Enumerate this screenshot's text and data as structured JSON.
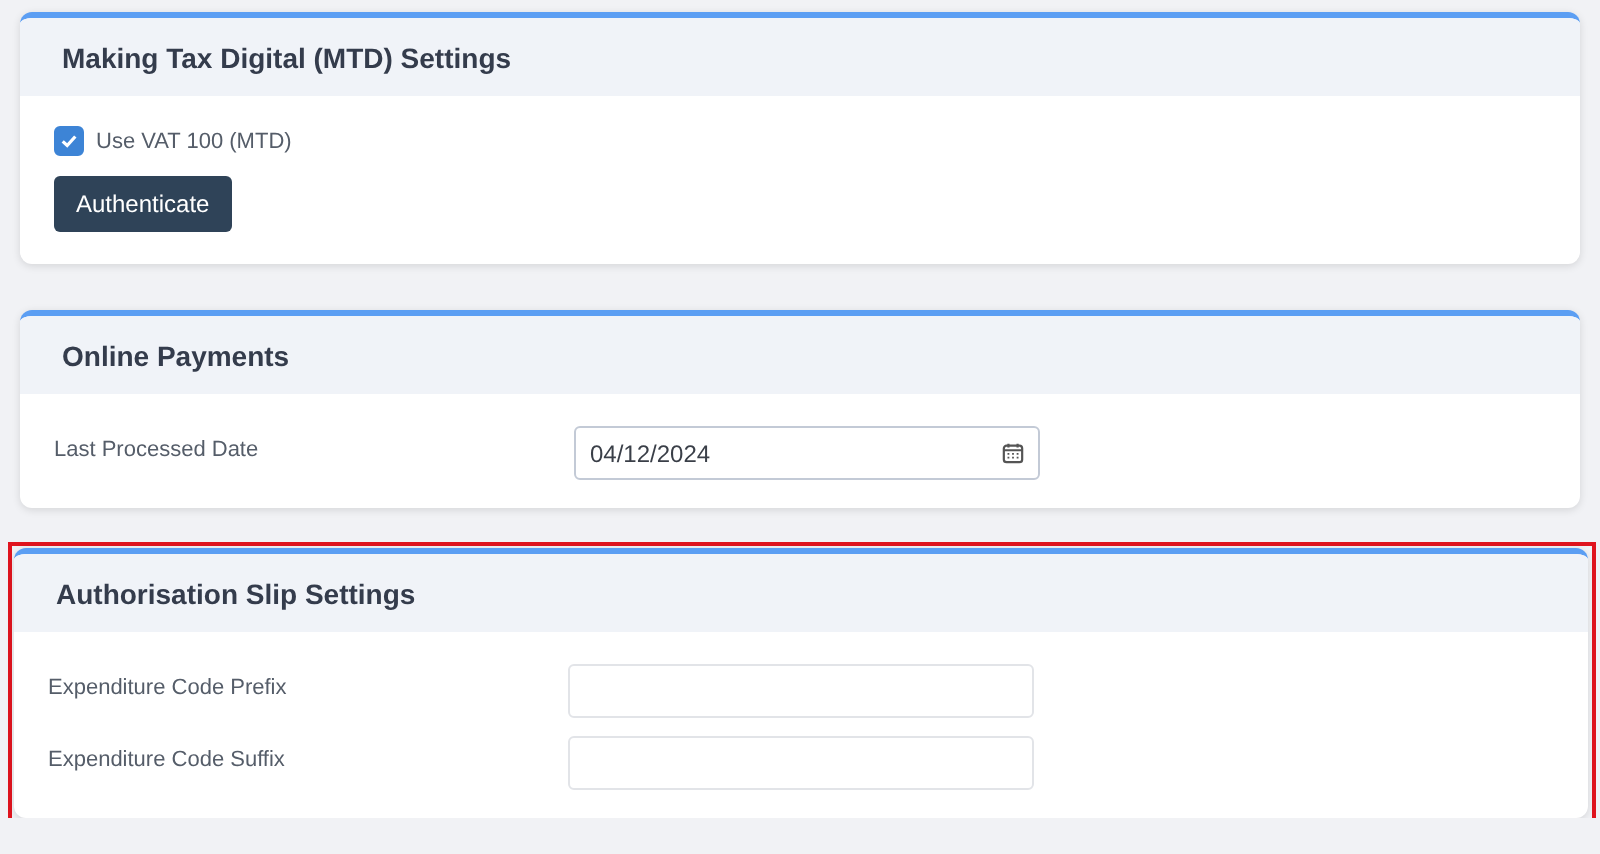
{
  "sections": [
    {
      "title": "Making Tax Digital (MTD) Settings",
      "highlighted": false,
      "fields": [
        {
          "kind": "checkbox",
          "label": "Use VAT 100 (MTD)",
          "checked": true
        },
        {
          "kind": "button",
          "label": "Authenticate"
        }
      ]
    },
    {
      "title": "Online Payments",
      "highlighted": false,
      "fields": [
        {
          "kind": "date",
          "label": "Last Processed Date",
          "value": "04/12/2024"
        }
      ]
    },
    {
      "title": "Authorisation Slip Settings",
      "highlighted": true,
      "fields": [
        {
          "kind": "text",
          "label": "Expenditure Code Prefix"
        },
        {
          "kind": "text",
          "label": "Expenditure Code Suffix"
        }
      ]
    }
  ]
}
